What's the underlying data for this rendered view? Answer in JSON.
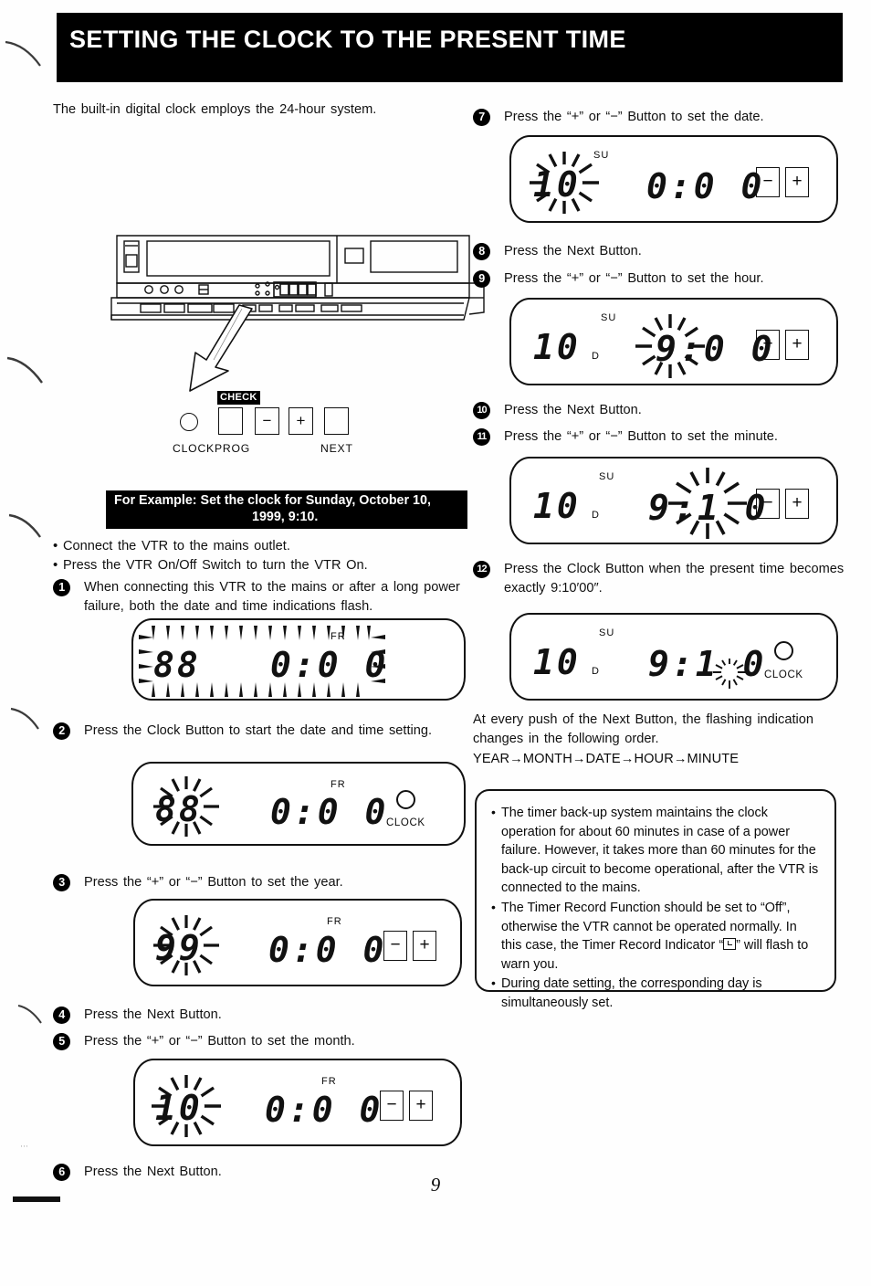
{
  "header": {
    "title": "SETTING THE CLOCK TO THE PRESENT TIME"
  },
  "intro": "The built-in digital clock employs the 24-hour system.",
  "legend": {
    "check_tag": "CHECK",
    "minus": "−",
    "plus": "+",
    "clock_label": "CLOCK",
    "prog_label": "PROG",
    "next_label": "NEXT"
  },
  "example": {
    "line1": "For Example:  Set the clock for Sunday, October 10,",
    "line2": "1999, 9:10."
  },
  "prep": [
    "Connect the VTR to the mains outlet.",
    "Press the VTR On/Off Switch to turn the VTR On."
  ],
  "steps": [
    {
      "num": "1",
      "text": "When connecting this VTR to the mains or after a long power failure, both the date and time indications flash."
    },
    {
      "num": "2",
      "text": "Press the Clock Button to start the date and time setting."
    },
    {
      "num": "3",
      "text": "Press the “+” or “−” Button to set the year."
    },
    {
      "num": "4",
      "text": "Press the Next Button."
    },
    {
      "num": "5",
      "text": "Press the “+” or “−” Button to set the month."
    },
    {
      "num": "6",
      "text": "Press the Next Button."
    },
    {
      "num": "7",
      "text": "Press the “+” or “−” Button to set the date."
    },
    {
      "num": "8",
      "text": "Press the Next Button."
    },
    {
      "num": "9",
      "text": "Press the “+” or “−” Button to set the hour."
    },
    {
      "num": "10",
      "text": "Press the Next Button."
    },
    {
      "num": "11",
      "text": "Press the “+” or “−” Button to set the minute."
    },
    {
      "num": "12",
      "text": "Press the Clock Button when the present time becomes exactly 9:10′00″."
    }
  ],
  "displays": {
    "d1": {
      "left_digits": "88",
      "weekday": "FR",
      "time": "0:0 0",
      "flash": "all"
    },
    "d2": {
      "left_digits": "88",
      "weekday": "FR",
      "time": "0:0 0",
      "clock_label": "CLOCK",
      "flash": "left"
    },
    "d3": {
      "left_digits": "99",
      "weekday": "FR",
      "time": "0:0 0",
      "minus": "−",
      "plus": "+",
      "flash": "left"
    },
    "d5": {
      "left_digits": "10",
      "weekday": "FR",
      "time": "0:0 0",
      "minus": "−",
      "plus": "+",
      "flash": "left"
    },
    "d7": {
      "left_digits": "10",
      "weekday": "SU",
      "time": "0:0 0",
      "minus": "−",
      "plus": "+",
      "flash": "left"
    },
    "d9": {
      "left_digits": "10",
      "day_mark": "D",
      "weekday": "SU",
      "time_hour": "9",
      "time_rest": ":0 0",
      "minus": "−",
      "plus": "+",
      "flash": "hour"
    },
    "d11": {
      "left_digits": "10",
      "day_mark": "D",
      "weekday": "SU",
      "time_hour": "9",
      "time_rest": ":1 0",
      "minus": "−",
      "plus": "+",
      "flash": "minute"
    },
    "d12": {
      "left_digits": "10",
      "day_mark": "D",
      "weekday": "SU",
      "time": "9:1 0",
      "clock_label": "CLOCK",
      "flash": "seconds"
    }
  },
  "order": {
    "intro": "At every push of the Next Button, the flashing indication changes in the following order.",
    "sequence": "YEAR→MONTH→DATE→HOUR→MINUTE"
  },
  "notes": [
    "The timer back-up system maintains the clock operation for about 60 minutes in case of a power failure. However, it takes more than 60 minutes for the back-up circuit to become operational, after the VTR is connected to the mains.",
    "The Timer Record Function should be set to “Off”, otherwise the VTR cannot be operated normally. In this case, the Timer Record Indicator “□” will flash to warn you.",
    "During date setting, the corresponding day is simultaneously set."
  ],
  "note2_parts": {
    "a": "The Timer Record Function should be set to “Off”, otherwise the VTR cannot be operated normally. In this case, the Timer Record Indicator “",
    "b": "” will flash to warn you."
  },
  "page_number": "9",
  "colors": {
    "ink": "#111111",
    "paper": "#ffffff",
    "band": "#000000"
  }
}
